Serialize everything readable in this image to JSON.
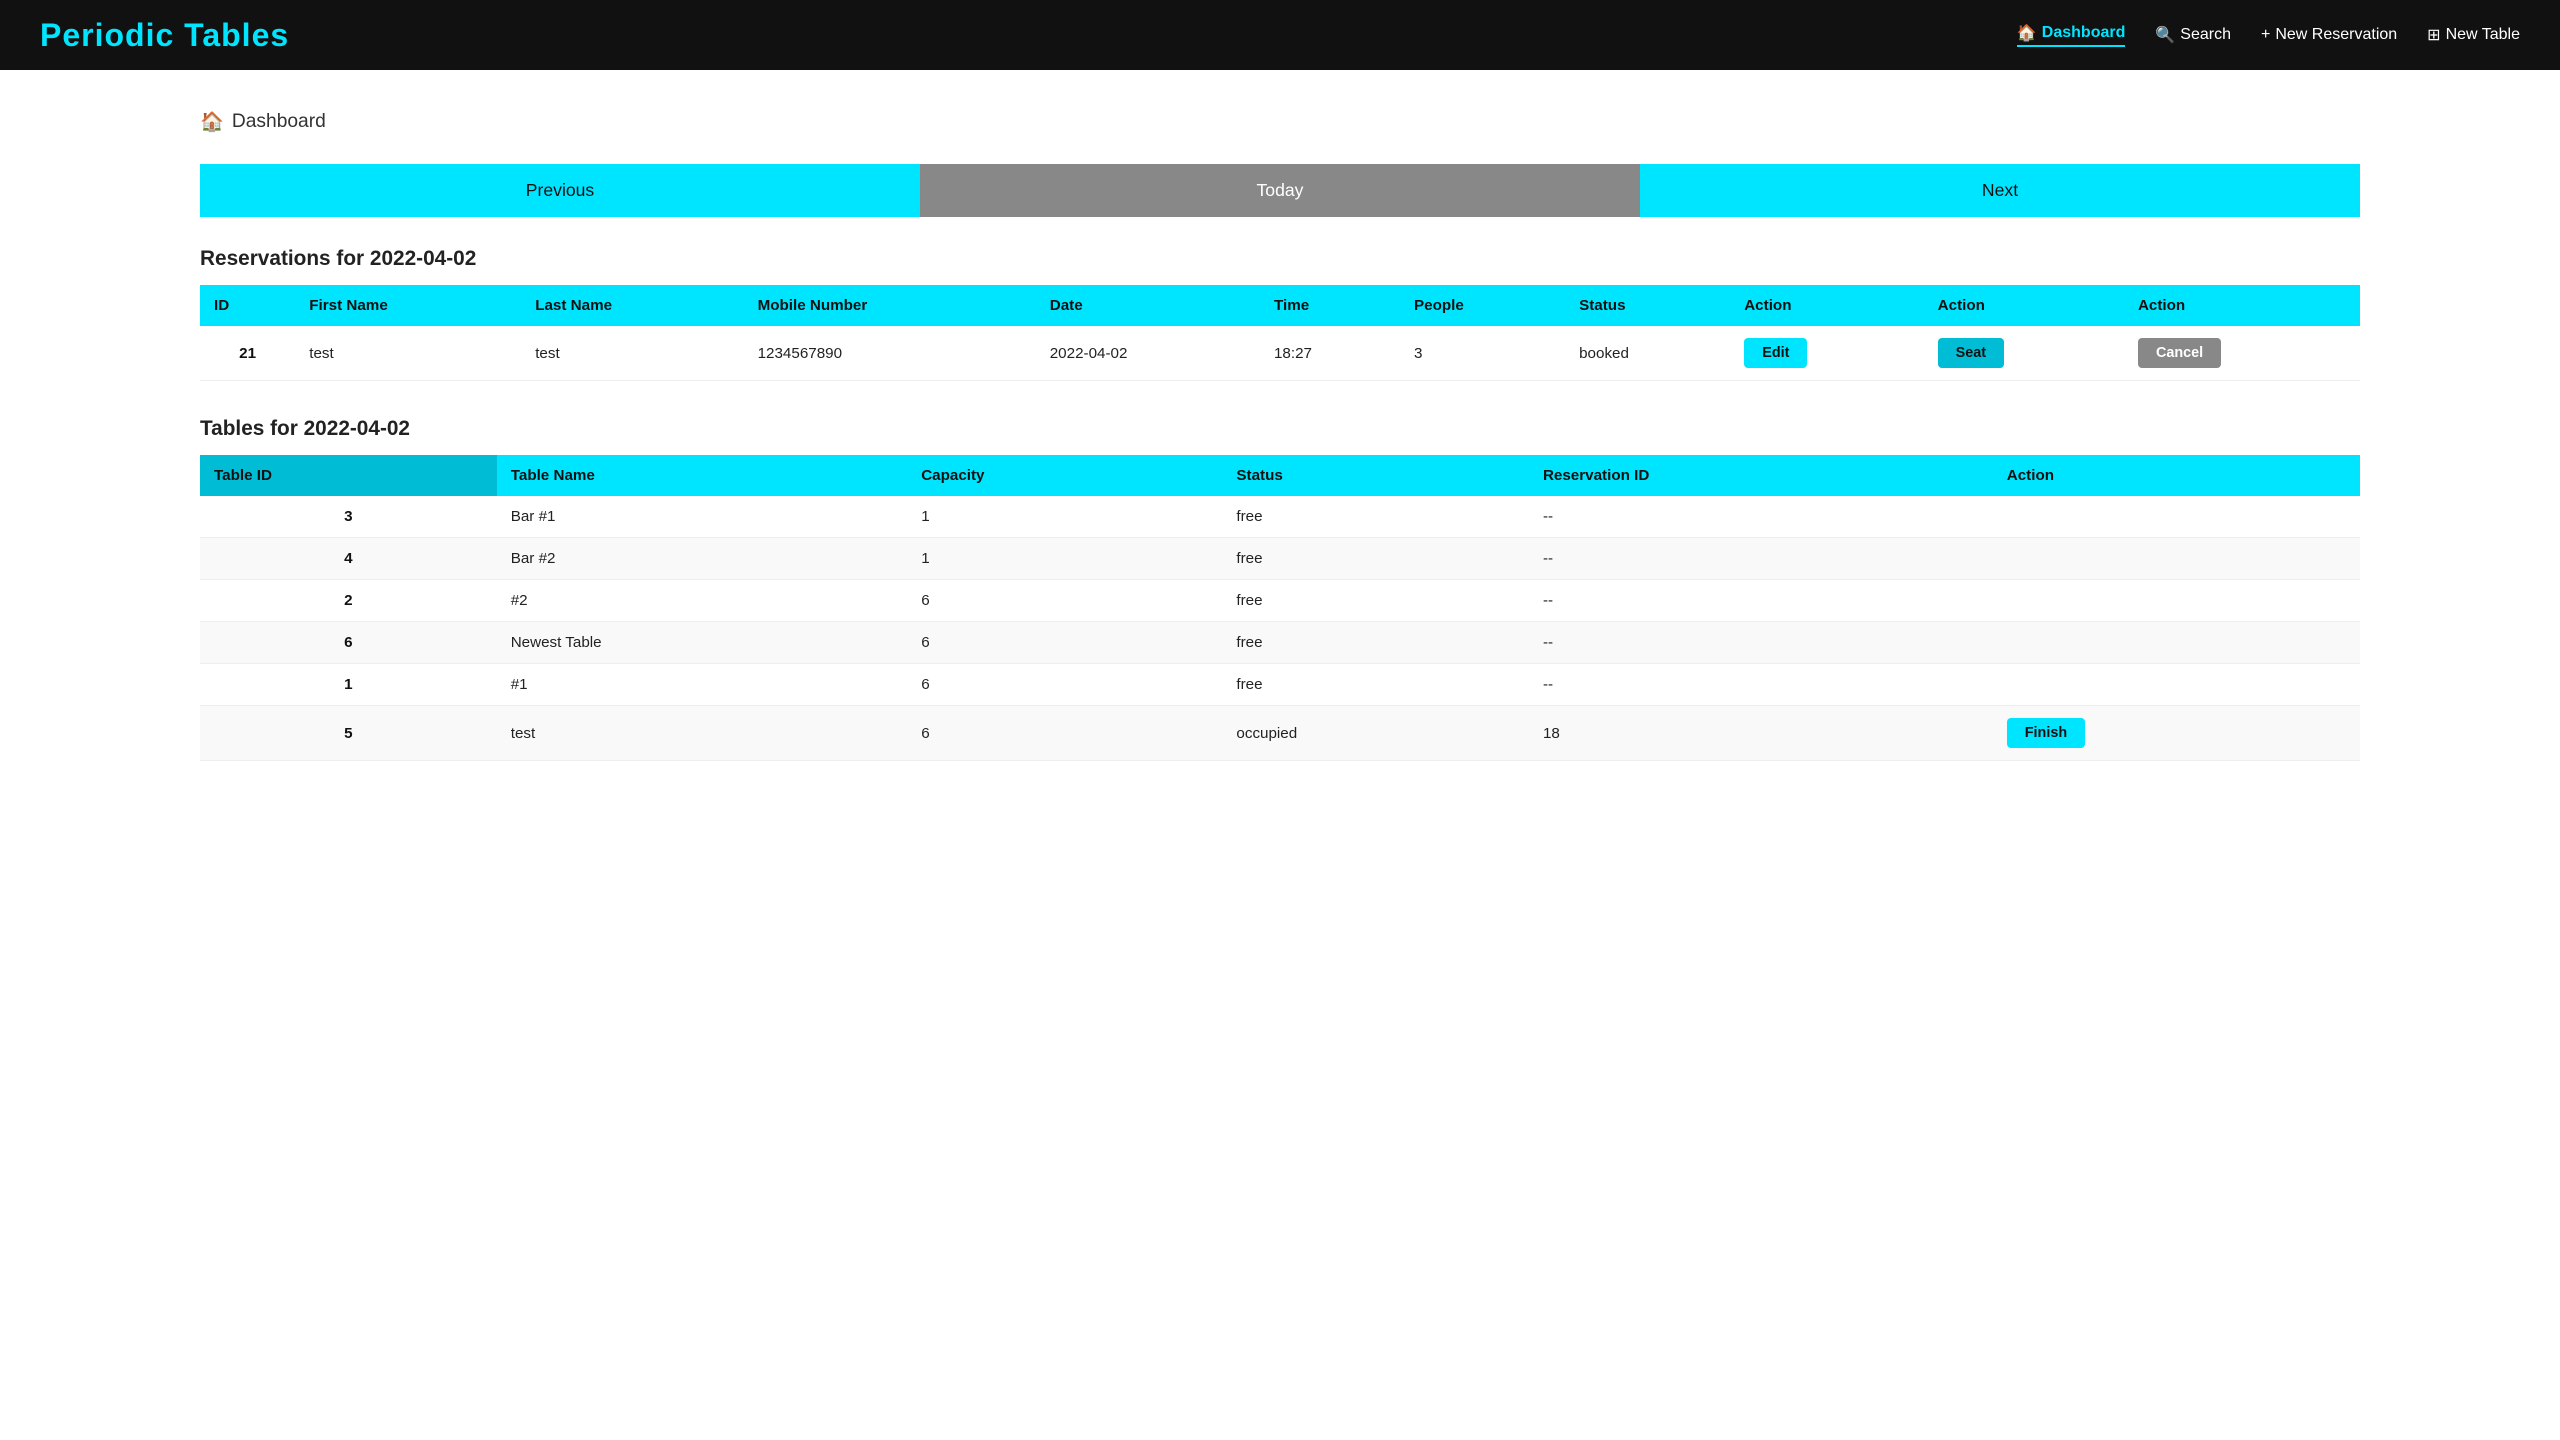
{
  "navbar": {
    "brand": "Periodic Tables",
    "links": [
      {
        "label": "Dashboard",
        "icon": "🏠",
        "active": true
      },
      {
        "label": "Search",
        "icon": "🔍",
        "active": false
      },
      {
        "label": "New Reservation",
        "icon": "+",
        "active": false
      },
      {
        "label": "New Table",
        "icon": "⊞",
        "active": false
      }
    ]
  },
  "breadcrumb": {
    "icon": "🏠",
    "label": "Dashboard"
  },
  "buttons": {
    "previous": "Previous",
    "today": "Today",
    "next": "Next"
  },
  "reservations": {
    "title": "Reservations for 2022-04-02",
    "columns": [
      "ID",
      "First Name",
      "Last Name",
      "Mobile Number",
      "Date",
      "Time",
      "People",
      "Status",
      "Action",
      "Action",
      "Action"
    ],
    "rows": [
      {
        "id": "21",
        "first_name": "test",
        "last_name": "test",
        "mobile": "1234567890",
        "date": "2022-04-02",
        "time": "18:27",
        "people": "3",
        "status": "booked",
        "action1": "Edit",
        "action2": "Seat",
        "action3": "Cancel"
      }
    ]
  },
  "tables": {
    "title": "Tables for 2022-04-02",
    "columns": [
      "Table ID",
      "Table Name",
      "Capacity",
      "Status",
      "Reservation ID",
      "Action"
    ],
    "rows": [
      {
        "id": "3",
        "name": "Bar #1",
        "capacity": "1",
        "status": "free",
        "reservation_id": "--",
        "action": ""
      },
      {
        "id": "4",
        "name": "Bar #2",
        "capacity": "1",
        "status": "free",
        "reservation_id": "--",
        "action": ""
      },
      {
        "id": "2",
        "name": "#2",
        "capacity": "6",
        "status": "free",
        "reservation_id": "--",
        "action": ""
      },
      {
        "id": "6",
        "name": "Newest Table",
        "capacity": "6",
        "status": "free",
        "reservation_id": "--",
        "action": ""
      },
      {
        "id": "1",
        "name": "#1",
        "capacity": "6",
        "status": "free",
        "reservation_id": "--",
        "action": ""
      },
      {
        "id": "5",
        "name": "test",
        "capacity": "6",
        "status": "occupied",
        "reservation_id": "18",
        "action": "Finish"
      }
    ]
  }
}
